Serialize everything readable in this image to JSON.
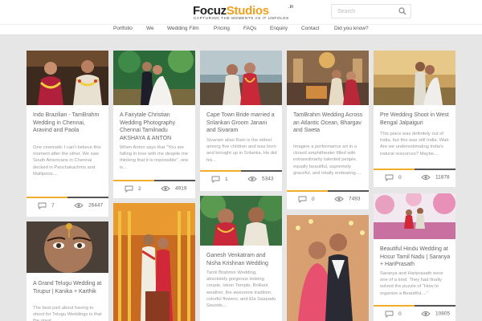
{
  "header": {
    "logo_word1": "Focuz",
    "logo_word2": "Studios",
    "logo_suffix": ".in",
    "logo_tagline": "CAPTURING THE MOMENTS AS IT UNFOLDS",
    "search_placeholder": "Search"
  },
  "nav": {
    "items": [
      "Portfolio",
      "We",
      "Wedding Film",
      "Pricing",
      "FAQs",
      "Enquiry",
      "Contact",
      "Did you know?"
    ]
  },
  "colors": {
    "accent": "#f2ad2a",
    "background": "#e6e6e6",
    "card": "#ffffff"
  },
  "icons": {
    "search": "search-icon",
    "comment": "comment-icon",
    "views": "eye-icon"
  },
  "cards": [
    {
      "title": "Indo Brazilian - TamBrahm Wedding in Chennai, Aravind and Paola",
      "excerpt": "One cinematic I can't believe this moment after the other. We saw South Americans in Chennai decked in Panchakachms and Mallipoos....",
      "comments": "7",
      "views": "26447"
    },
    {
      "title": "A Fairytale Christian Wedding Photography Chennai Tamilnadu AKSHAYA & ANTON",
      "excerpt": "When Anton says that \"You are falling in love with me despite me thinking that it is impossible\", one is...",
      "comments": "2",
      "views": "4919"
    },
    {
      "title": "Cape Town Bride married a Srilankan Groom Janani and Sivaram",
      "excerpt": "Sivaram alias Ram is the eldest among five children and was born and brought up in Srilanka. He did his...",
      "comments": "1",
      "views": "5343"
    },
    {
      "title": "TamBrahm Wedding Across an Atlantic Ocean, Bhargav and Sweta",
      "excerpt": "Imagine a performance art in a closed amphitheater filled with extraordinarily talented people, equally beautiful, supremely graceful, and totally endearing....",
      "comments": "0",
      "views": "7493"
    },
    {
      "title": "Pre Wedding Shoot in West Bengal Jalpaiguri",
      "excerpt": "This place was definitely out of India, but this was still India. Wait. Are we underestimating India's natural resources? Maybe....",
      "comments": "0",
      "views": "11878"
    },
    {
      "title": "A Grand Telugu Wedding at Tirupur | Kanika + Karthik",
      "excerpt": "The best part about having to shoot for Telugu Weddings is that the great"
    },
    {
      "title": "Ganesh Venkatram and Nisha Krishnan Wedding",
      "excerpt": "Tamil Brahmin Wedding, absolutely gorgeous looking couple, Iskon Temple, Brilliant weather, the awesome tradition, colorful flowers, and Ela Saapadu Sounds...."
    },
    {
      "title": "Beautiful Hindu Wedding at Hosur Tamil Nadu | Saranya + HariPrasath",
      "excerpt": "Saranya and Hariprasath were one of a kind. They had finally solved the puzzle of \"How to organize a Beautiful....\"",
      "comments": "0",
      "views": "10805"
    }
  ]
}
